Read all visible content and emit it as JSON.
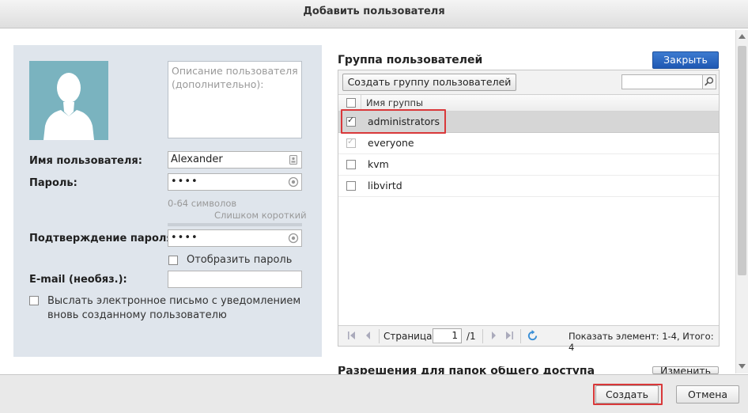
{
  "dialog": {
    "title": "Добавить пользователя"
  },
  "user_form": {
    "description_placeholder": "Описание пользователя (дополнительно):",
    "username_label": "Имя пользователя:",
    "username_value": "Alexander",
    "password_label": "Пароль:",
    "password_value": "••••",
    "password_hint": "0-64 символов",
    "password_strength": "Слишком короткий",
    "confirm_label": "Подтверждение пароля:",
    "confirm_value": "••••",
    "show_password_label": "Отобразить пароль",
    "show_password_checked": false,
    "email_label": "E-mail (необяз.):",
    "email_value": "",
    "notify_label_line1": "Выслать электронное письмо с уведомлением",
    "notify_label_line2": "вновь созданному пользователю",
    "notify_checked": false
  },
  "groups": {
    "title": "Группа пользователей",
    "close_button": "Закрыть",
    "create_group_button": "Создать группу пользователей",
    "search_value": "",
    "column_name": "Имя группы",
    "rows": [
      {
        "name": "administrators",
        "checked": true,
        "disabled": false,
        "selected": true
      },
      {
        "name": "everyone",
        "checked": true,
        "disabled": true,
        "selected": false
      },
      {
        "name": "kvm",
        "checked": false,
        "disabled": false,
        "selected": false
      },
      {
        "name": "libvirtd",
        "checked": false,
        "disabled": false,
        "selected": false
      }
    ],
    "pager": {
      "page_label": "Страница",
      "page_value": "1",
      "page_total": "/1",
      "summary": "Показать элемент: 1-4, Итого: 4"
    }
  },
  "share_permissions": {
    "title": "Разрешения для папок общего доступа",
    "edit_button": "Изменить"
  },
  "footer": {
    "create_button": "Создать",
    "cancel_button": "Отмена"
  },
  "colors": {
    "accent": "#1e58b3",
    "highlight": "#d9383a",
    "avatar_bg": "#7ab3bf",
    "left_panel_bg": "#dfe5ec"
  }
}
